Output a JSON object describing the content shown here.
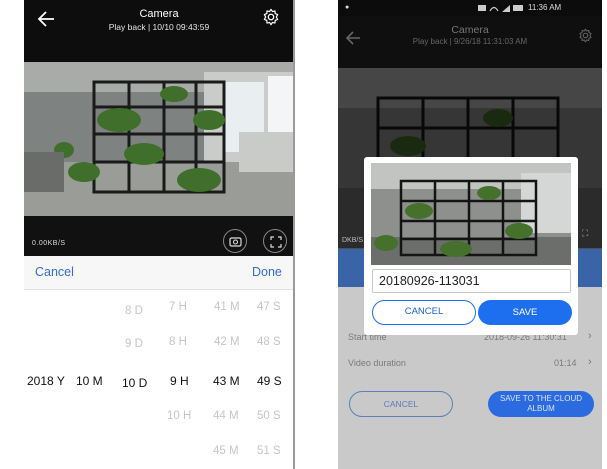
{
  "left": {
    "header": {
      "title": "Camera",
      "subtitle": "Play back | 10/10 09:43:59"
    },
    "video": {
      "overlay_text": "0.00KB/S"
    },
    "picker": {
      "cancel_label": "Cancel",
      "done_label": "Done",
      "rows": [
        {
          "d": "8 D",
          "h": "7 H",
          "m": "41 M",
          "s": "47 S"
        },
        {
          "d": "9 D",
          "h": "8 H",
          "m": "42 M",
          "s": "48 S"
        },
        {
          "y": "2018 Y",
          "mo": "10 M",
          "d": "10 D",
          "h": "9 H",
          "m": "43 M",
          "s": "49 S"
        },
        {
          "h": "10 H",
          "m": "44 M",
          "s": "50 S"
        },
        {
          "m": "45 M",
          "s": "51 S"
        }
      ]
    }
  },
  "right": {
    "status_bar": {
      "time": "11:36 AM"
    },
    "header": {
      "title": "Camera",
      "subtitle": "Play back | 9/26/18 11:31:03 AM"
    },
    "video": {
      "overlay_text": "DKB/S"
    },
    "dialog": {
      "filename": "20180926-113031",
      "cancel_label": "CANCEL",
      "save_label": "SAVE"
    },
    "form": {
      "start_time_label": "Start time",
      "start_time_value": "2018-09-26 11:30:31",
      "duration_label": "Video duration",
      "duration_value": "01:14",
      "cancel_label": "CANCEL",
      "save_cloud_label": "SAVE TO THE CLOUD ALBUM"
    }
  }
}
